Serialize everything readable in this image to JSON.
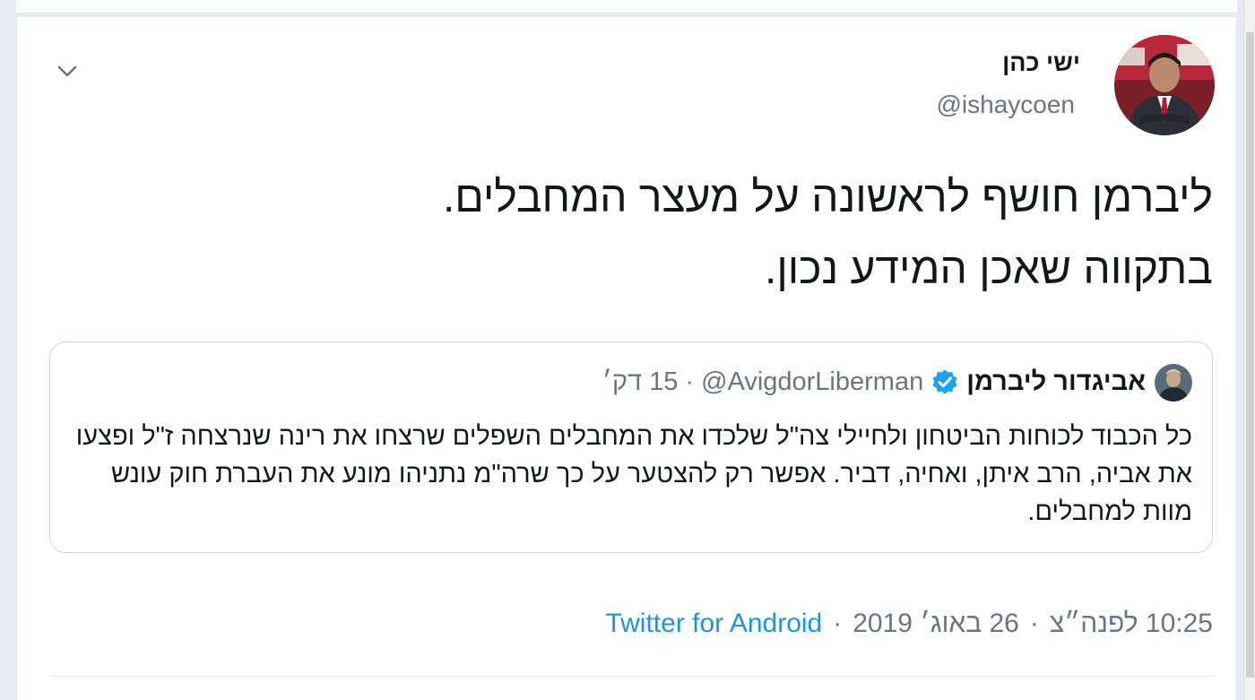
{
  "tweet": {
    "author": {
      "display_name": "ישי כהן",
      "handle": "@ishaycoen",
      "avatar_icon": "profile-photo"
    },
    "text_lines": [
      "ליברמן חושף לראשונה על מעצר המחבלים.",
      "בתקווה שאכן המידע נכון."
    ],
    "quoted": {
      "display_name": "אביגדור ליברמן",
      "verified_icon": "verified-badge-icon",
      "handle": "@AvigdorLiberman",
      "separator": "·",
      "time": "15 דק׳",
      "text": "כל הכבוד לכוחות הביטחון ולחיילי צה\"ל שלכדו את המחבלים השפלים שרצחו את רינה שנרצחה ז\"ל ופצעו את אביה, הרב איתן, ואחיה, דביר. אפשר רק להצטער על כך שרה\"מ נתניהו מונע את העברת חוק עונש מוות למחבלים."
    },
    "meta": {
      "time": "10:25 לפנה״צ",
      "date": "26 באוג׳ 2019",
      "separator": "·",
      "source": "Twitter for Android"
    }
  },
  "colors": {
    "link": "#1b95e0",
    "muted": "#657786",
    "text": "#14171a",
    "border": "#ccd6dd",
    "verified": "#1da1f2"
  }
}
